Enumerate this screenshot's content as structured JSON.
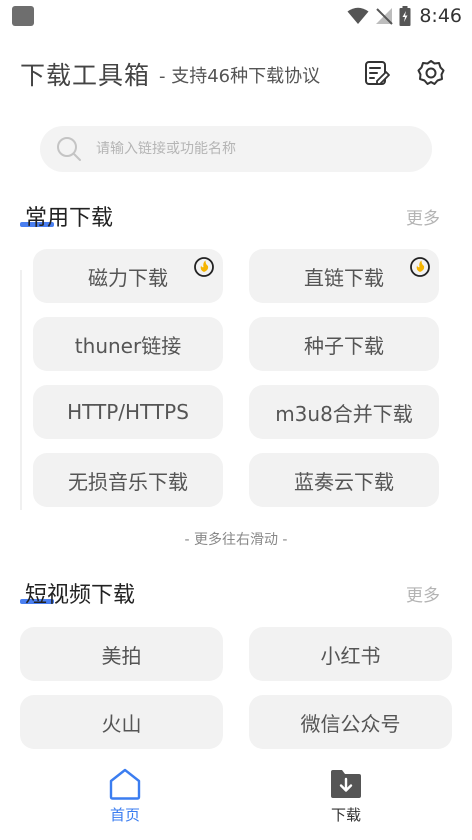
{
  "status_bar": {
    "time": "8:46"
  },
  "header": {
    "title": "下载工具箱",
    "subtitle": "- 支持46种下载协议"
  },
  "search": {
    "placeholder": "请输入链接或功能名称"
  },
  "sections": {
    "common": {
      "title": "常用下载",
      "more": "更多",
      "items": [
        {
          "label": "磁力下载",
          "badge": true
        },
        {
          "label": "直链下载",
          "badge": true
        },
        {
          "label": "thuner链接",
          "badge": false
        },
        {
          "label": "种子下载",
          "badge": false
        },
        {
          "label": "HTTP/HTTPS",
          "badge": false
        },
        {
          "label": "m3u8合并下载",
          "badge": false
        },
        {
          "label": "无损音乐下载",
          "badge": false
        },
        {
          "label": "蓝奏云下载",
          "badge": false
        }
      ],
      "swipe_hint": "- 更多往右滑动 -"
    },
    "short_video": {
      "title": "短视频下载",
      "more": "更多",
      "items": [
        {
          "label": "美拍"
        },
        {
          "label": "小红书"
        },
        {
          "label": "火山"
        },
        {
          "label": "微信公众号"
        }
      ]
    }
  },
  "bottom_nav": {
    "home_label": "首页",
    "download_label": "下载"
  },
  "colors": {
    "accent": "#3b7df0",
    "button_bg": "#f2f2f2",
    "badge": "#f5b400"
  }
}
